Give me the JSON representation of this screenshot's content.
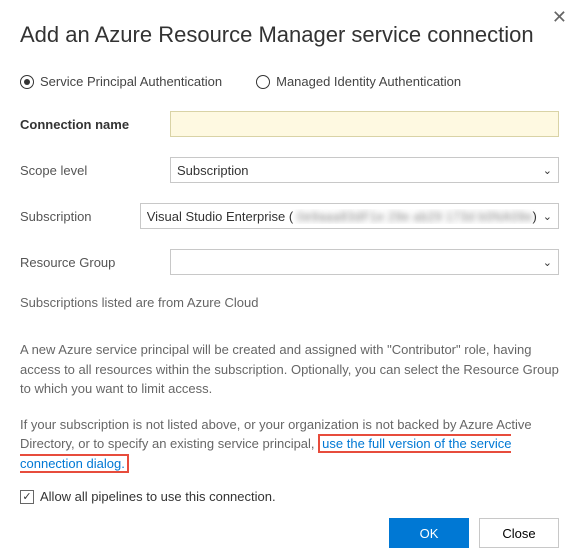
{
  "dialog": {
    "title": "Add an Azure Resource Manager service connection"
  },
  "authType": {
    "servicePrincipal": "Service Principal Authentication",
    "managedIdentity": "Managed Identity Authentication"
  },
  "fields": {
    "connectionName": {
      "label": "Connection name",
      "value": ""
    },
    "scopeLevel": {
      "label": "Scope level",
      "value": "Subscription"
    },
    "subscription": {
      "label": "Subscription",
      "prefix": "Visual Studio Enterprise ( ",
      "masked": "0e9aaa83dF1e 29e ab29 173d b0NA09e",
      "suffix": ")"
    },
    "resourceGroup": {
      "label": "Resource Group",
      "value": ""
    }
  },
  "info": {
    "cloudNote": "Subscriptions listed are from Azure Cloud",
    "principalNote": "A new Azure service principal will be created and assigned with \"Contributor\" role, having access to all resources within the subscription. Optionally, you can select the Resource Group to which you want to limit access.",
    "fallbackNotePrefix": "If your subscription is not listed above, or your organization is not backed by Azure Active Directory, or to specify an existing service principal, ",
    "fallbackLink": "use the full version of the service connection dialog."
  },
  "allowPipelines": {
    "label": "Allow all pipelines to use this connection.",
    "checked": true
  },
  "buttons": {
    "ok": "OK",
    "close": "Close"
  }
}
